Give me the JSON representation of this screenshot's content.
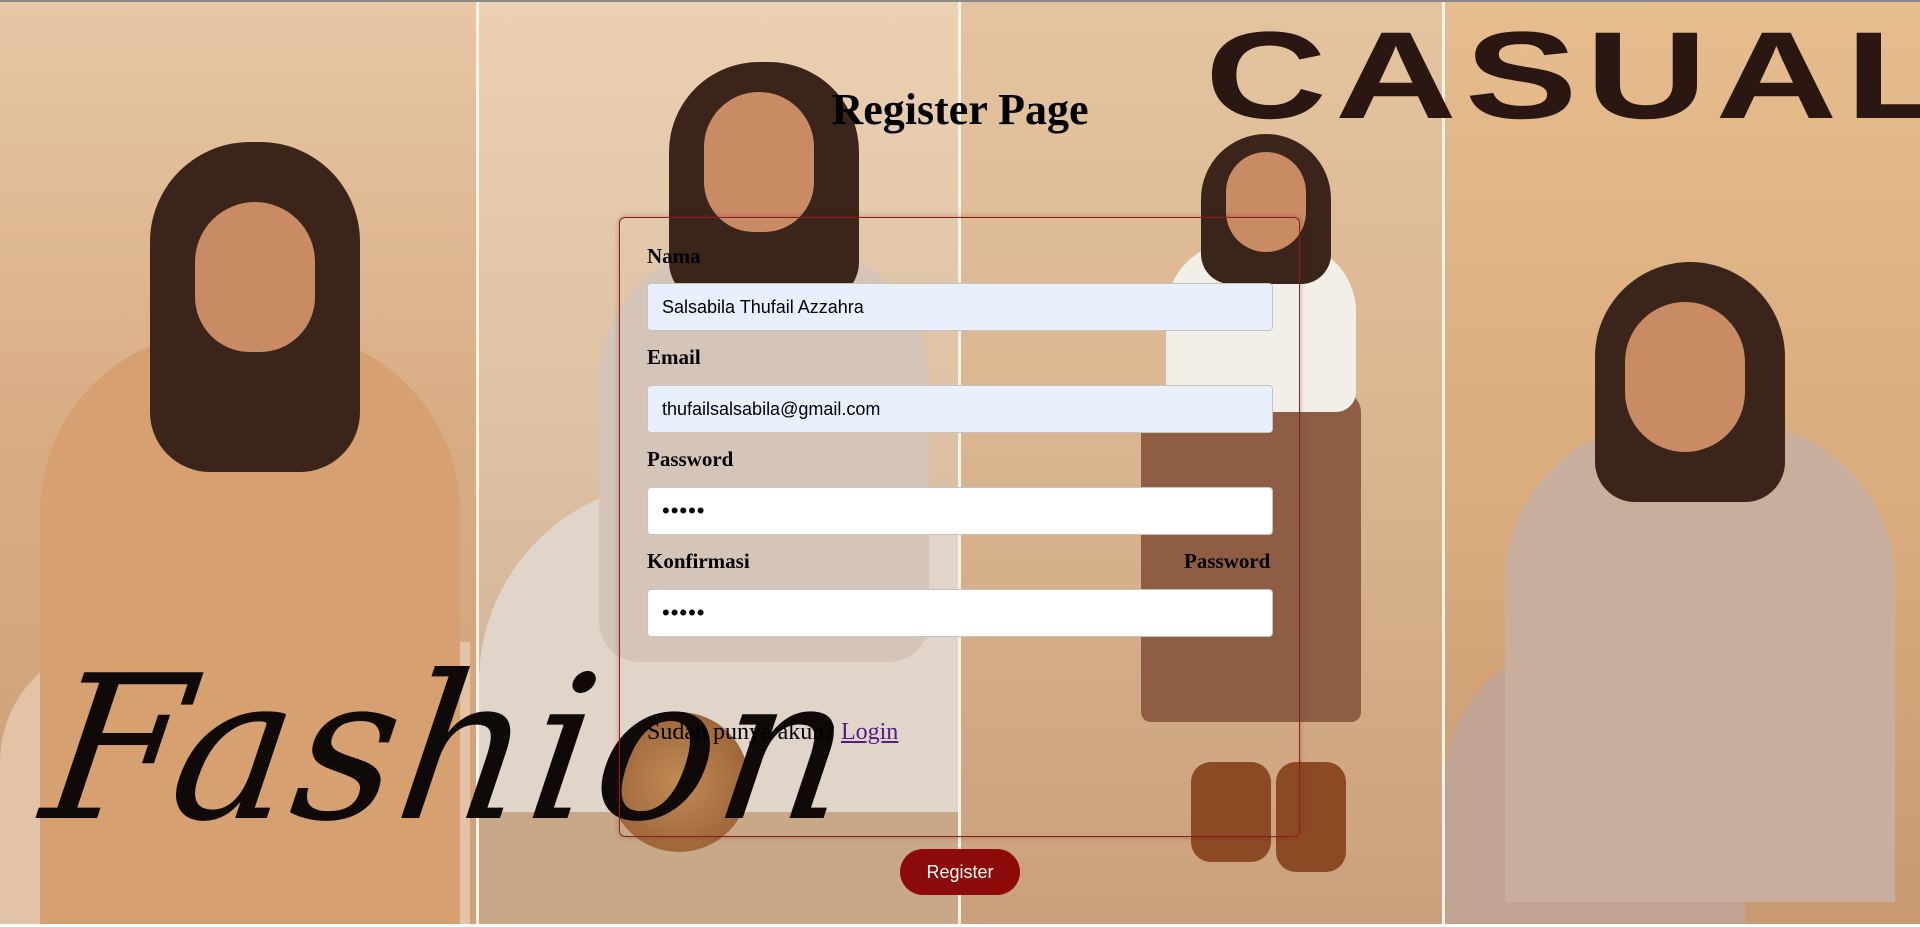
{
  "decor": {
    "casual_wordmark": "CASUAL",
    "fashion_script": "Fashion"
  },
  "page": {
    "title": "Register Page"
  },
  "form": {
    "nama_label": "Nama",
    "nama_value": "Salsabila Thufail Azzahra",
    "email_label": "Email",
    "email_value": "thufailsalsabila@gmail.com",
    "password_label": "Password",
    "password_value": "•••••",
    "confirm_label_left": "Konfirmasi",
    "confirm_label_right": "Password",
    "confirm_value": "•••••",
    "have_account_text": "Sudah punya akun?",
    "login_link": "Login",
    "register_button": "Register"
  },
  "colors": {
    "accent": "#8c0a0a",
    "autofill_bg": "#e8f0fe",
    "link": "#551a8b"
  }
}
